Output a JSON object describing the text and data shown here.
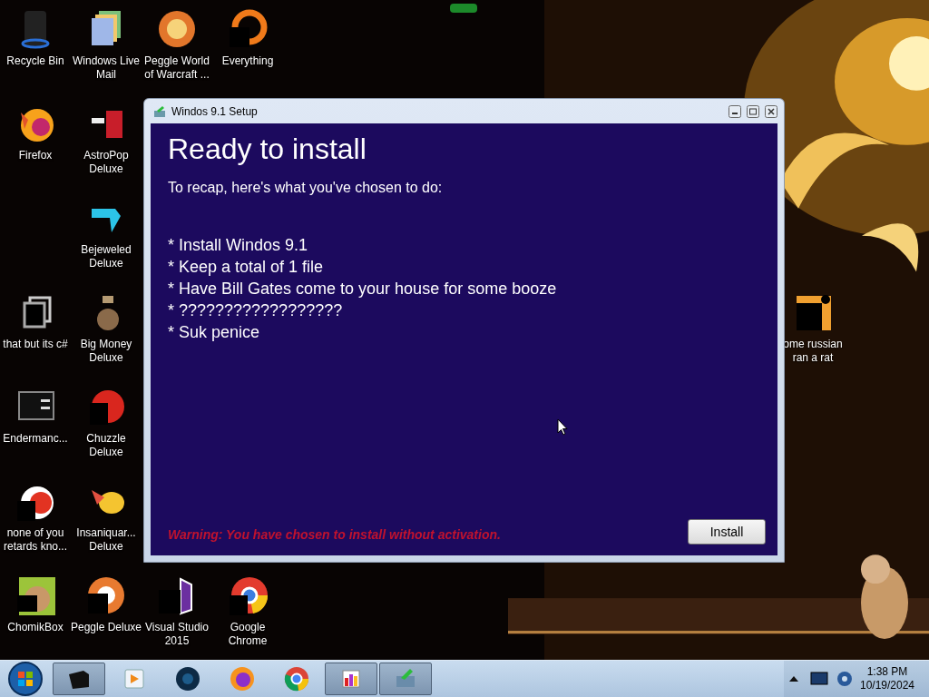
{
  "desktop_icons": [
    {
      "label": "Recycle Bin"
    },
    {
      "label": "Windows Live Mail"
    },
    {
      "label": "Peggle World of Warcraft ..."
    },
    {
      "label": "Everything"
    },
    {
      "label": "Firefox"
    },
    {
      "label": "AstroPop Deluxe"
    },
    {
      "label": "Bejeweled Deluxe"
    },
    {
      "label": "that but its c#"
    },
    {
      "label": "Big Money Deluxe"
    },
    {
      "label": "ome russian ran a rat"
    },
    {
      "label": "Endermanc..."
    },
    {
      "label": "Chuzzle Deluxe"
    },
    {
      "label": "none of you retards kno..."
    },
    {
      "label": "Insaniquar... Deluxe"
    },
    {
      "label": "ChomikBox"
    },
    {
      "label": "Peggle Deluxe"
    },
    {
      "label": "Visual Studio 2015"
    },
    {
      "label": "Google Chrome"
    }
  ],
  "window": {
    "title": "Windos 9.1 Setup",
    "heading": "Ready to install",
    "intro": "To recap, here's what you've chosen to do:",
    "items": [
      "* Install Windos 9.1",
      "* Keep a total of 1 file",
      "* Have Bill Gates come to your house for some booze",
      "* ??????????????????",
      "* Suk penice"
    ],
    "warning": "Warning: You have chosen to install without activation.",
    "button": "Install"
  },
  "taskbar": {
    "items": [
      {
        "running": true
      },
      {
        "running": false
      },
      {
        "running": false
      },
      {
        "running": false
      },
      {
        "running": false
      },
      {
        "running": true
      },
      {
        "running": true
      }
    ],
    "clock": {
      "time": "1:38 PM",
      "date": "10/19/2024"
    }
  }
}
